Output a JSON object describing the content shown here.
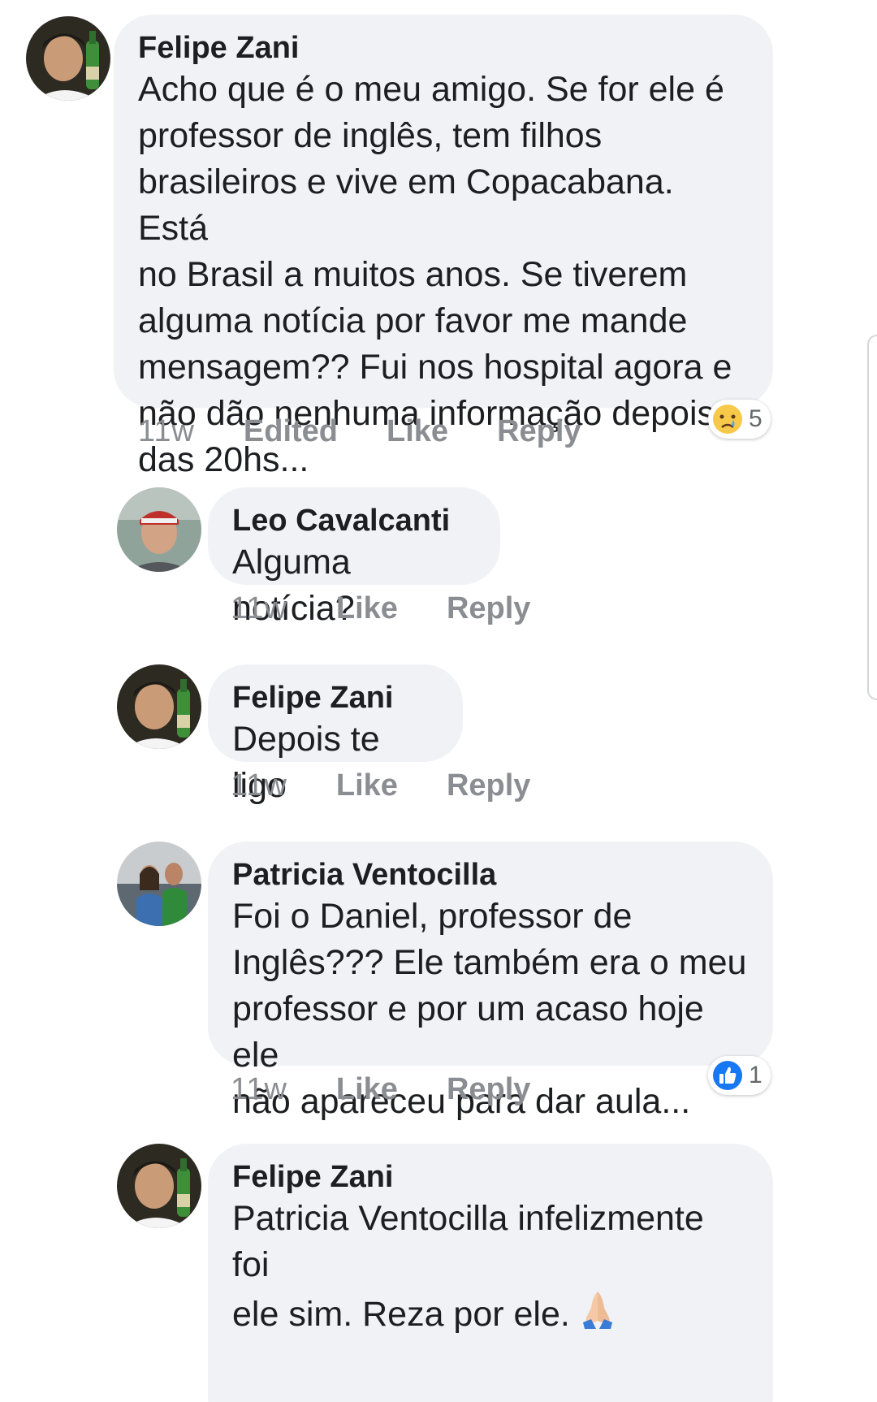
{
  "comments": [
    {
      "author": "Felipe Zani",
      "text": "Acho que é o meu amigo. Se for ele é\nprofessor de inglês, tem filhos\nbrasileiros e vive em Copacabana. Está\nno Brasil a muitos anos. Se tiverem\nalguma notícia por favor me mande\nmensagem?? Fui nos hospital agora e\nnão dão nenhuma informação depois\ndas 20hs...",
      "time": "11w",
      "edited": "Edited",
      "like": "Like",
      "reply": "Reply",
      "reaction": {
        "icon": "sad-face-icon",
        "count": "5"
      }
    },
    {
      "author": "Leo Cavalcanti",
      "text": "Alguma notícia?",
      "time": "11w",
      "like": "Like",
      "reply": "Reply"
    },
    {
      "author": "Felipe Zani",
      "text": "Depois te ligo",
      "time": "11w",
      "like": "Like",
      "reply": "Reply"
    },
    {
      "author": "Patricia Ventocilla",
      "text": "Foi o Daniel, professor de\nInglês??? Ele também era o meu\nprofessor e por um acaso hoje ele\nnão apareceu para dar aula...",
      "time": "11w",
      "like": "Like",
      "reply": "Reply",
      "reaction": {
        "icon": "thumbs-up-icon",
        "count": "1"
      }
    },
    {
      "author": "Felipe Zani",
      "text": "Patricia Ventocilla infelizmente foi\nele sim. Reza por ele.",
      "emoji": "praying-hands-icon"
    }
  ],
  "colors": {
    "bubble": "#f0f2f5",
    "meta_text": "#8a8d91",
    "like_blue": "#1877f2",
    "sad_yellow": "#f7c94b"
  }
}
